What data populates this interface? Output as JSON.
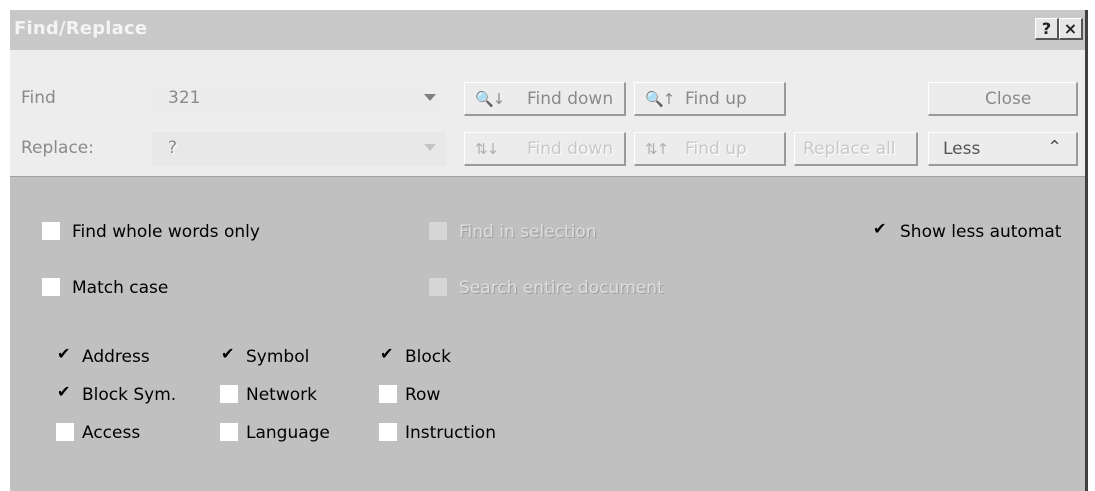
{
  "title": "Find/Replace",
  "title_buttons": {
    "help": "?",
    "close": "×"
  },
  "find": {
    "label": "Find",
    "value": "321"
  },
  "replace": {
    "label": "Replace:",
    "value": "?"
  },
  "buttons": {
    "find_down": "Find down",
    "find_up": "Find up",
    "replace_find_down": "Find down",
    "replace_find_up": "Find up",
    "replace_all": "Replace all",
    "close": "Close",
    "less": "Less",
    "less_icon": "double-chevron-up-icon",
    "find_down_icon": "binoculars-down-icon",
    "find_up_icon": "binoculars-up-icon",
    "replace_down_icon": "replace-down-icon",
    "replace_up_icon": "replace-up-icon"
  },
  "options": {
    "whole_words": {
      "label": "Find whole words only",
      "checked": false
    },
    "in_selection": {
      "label": "Find in selection",
      "checked": false,
      "disabled": true
    },
    "show_less": {
      "label": "Show less automat",
      "checked": true
    },
    "match_case": {
      "label": "Match case",
      "checked": false
    },
    "entire_document": {
      "label": "Search entire document",
      "checked": false,
      "disabled": true
    }
  },
  "scopes": [
    {
      "label": "Address",
      "checked": true
    },
    {
      "label": "Symbol",
      "checked": true
    },
    {
      "label": "Block",
      "checked": true
    },
    {
      "label": "Block Sym.",
      "checked": true
    },
    {
      "label": "Network",
      "checked": false
    },
    {
      "label": "Row",
      "checked": false
    },
    {
      "label": "Access",
      "checked": false
    },
    {
      "label": "Language",
      "checked": false
    },
    {
      "label": "Instruction",
      "checked": false
    }
  ],
  "colors": {
    "panel": "#c0c0c0",
    "dialog": "#ededed",
    "titlebar": "#c8c8c8"
  }
}
